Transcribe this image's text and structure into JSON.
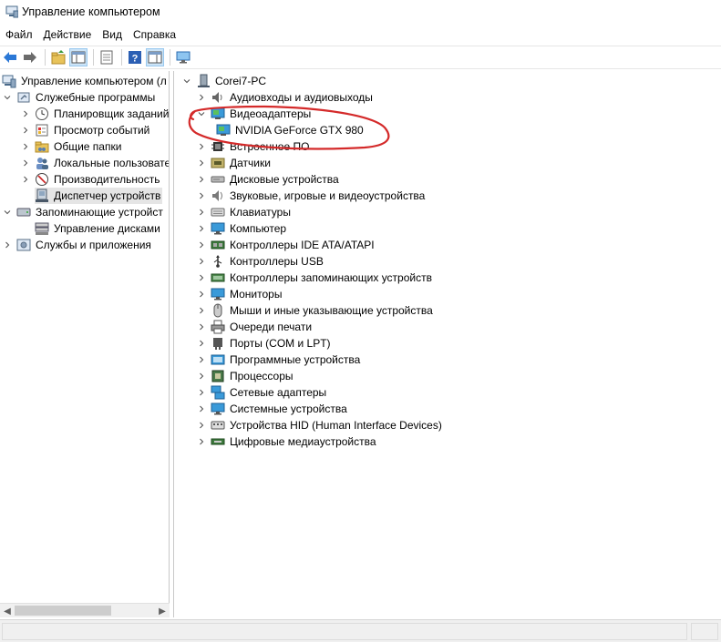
{
  "window": {
    "title": "Управление компьютером"
  },
  "menu": [
    "Файл",
    "Действие",
    "Вид",
    "Справка"
  ],
  "toolbar": {
    "buttons": [
      "back-icon",
      "forward-icon",
      "up-folder-icon",
      "show-hide-tree-icon",
      "properties-icon",
      "help-icon",
      "action-pane-icon",
      "monitor-icon"
    ]
  },
  "left_tree": [
    {
      "label": "Управление компьютером (л",
      "icon": "computer-management-icon",
      "level": 0,
      "chevron": "none"
    },
    {
      "label": "Служебные программы",
      "icon": "tools-icon",
      "level": 1,
      "chevron": "down"
    },
    {
      "label": "Планировщик заданий",
      "icon": "clock-icon",
      "level": 2,
      "chevron": "right"
    },
    {
      "label": "Просмотр событий",
      "icon": "event-viewer-icon",
      "level": 2,
      "chevron": "right"
    },
    {
      "label": "Общие папки",
      "icon": "shared-folder-icon",
      "level": 2,
      "chevron": "right"
    },
    {
      "label": "Локальные пользовате",
      "icon": "users-icon",
      "level": 2,
      "chevron": "right"
    },
    {
      "label": "Производительность",
      "icon": "performance-icon",
      "level": 2,
      "chevron": "right"
    },
    {
      "label": "Диспетчер устройств",
      "icon": "device-manager-icon",
      "level": 2,
      "chevron": "none",
      "selected": true
    },
    {
      "label": "Запоминающие устройст",
      "icon": "storage-icon",
      "level": 1,
      "chevron": "down"
    },
    {
      "label": "Управление дисками",
      "icon": "disk-management-icon",
      "level": 2,
      "chevron": "none"
    },
    {
      "label": "Службы и приложения",
      "icon": "services-icon",
      "level": 1,
      "chevron": "right"
    }
  ],
  "device_tree": {
    "root": {
      "label": "Corei7-PC",
      "icon": "computer-icon"
    },
    "categories": [
      {
        "label": "Аудиовходы и аудиовыходы",
        "icon": "audio-icon",
        "expanded": false
      },
      {
        "label": "Видеоадаптеры",
        "icon": "display-adapter-icon",
        "expanded": true
      },
      {
        "label": "NVIDIA GeForce GTX 980",
        "icon": "display-adapter-icon",
        "child": true
      },
      {
        "label": "Встроенное ПО",
        "icon": "firmware-icon",
        "expanded": false
      },
      {
        "label": "Датчики",
        "icon": "sensor-icon",
        "expanded": false
      },
      {
        "label": "Дисковые устройства",
        "icon": "disk-drive-icon",
        "expanded": false
      },
      {
        "label": "Звуковые, игровые и видеоустройства",
        "icon": "sound-icon",
        "expanded": false
      },
      {
        "label": "Клавиатуры",
        "icon": "keyboard-icon",
        "expanded": false
      },
      {
        "label": "Компьютер",
        "icon": "computer-icon",
        "expanded": false
      },
      {
        "label": "Контроллеры IDE ATA/ATAPI",
        "icon": "ide-controller-icon",
        "expanded": false
      },
      {
        "label": "Контроллеры USB",
        "icon": "usb-icon",
        "expanded": false
      },
      {
        "label": "Контроллеры запоминающих устройств",
        "icon": "storage-controller-icon",
        "expanded": false
      },
      {
        "label": "Мониторы",
        "icon": "monitor-icon",
        "expanded": false
      },
      {
        "label": "Мыши и иные указывающие устройства",
        "icon": "mouse-icon",
        "expanded": false
      },
      {
        "label": "Очереди печати",
        "icon": "printer-icon",
        "expanded": false
      },
      {
        "label": "Порты (COM и LPT)",
        "icon": "port-icon",
        "expanded": false
      },
      {
        "label": "Программные устройства",
        "icon": "software-device-icon",
        "expanded": false
      },
      {
        "label": "Процессоры",
        "icon": "processor-icon",
        "expanded": false
      },
      {
        "label": "Сетевые адаптеры",
        "icon": "network-adapter-icon",
        "expanded": false
      },
      {
        "label": "Системные устройства",
        "icon": "system-device-icon",
        "expanded": false
      },
      {
        "label": "Устройства HID (Human Interface Devices)",
        "icon": "hid-icon",
        "expanded": false
      },
      {
        "label": "Цифровые медиаустройства",
        "icon": "media-device-icon",
        "expanded": false
      }
    ]
  },
  "annotation": {
    "shape": "hand-drawn-ellipse",
    "color": "#d42a2a"
  },
  "colors": {
    "selected_row": "#e5e5e5",
    "toolbar_pressed": "#cce4f7",
    "icon_blue": "#2b78d6"
  }
}
